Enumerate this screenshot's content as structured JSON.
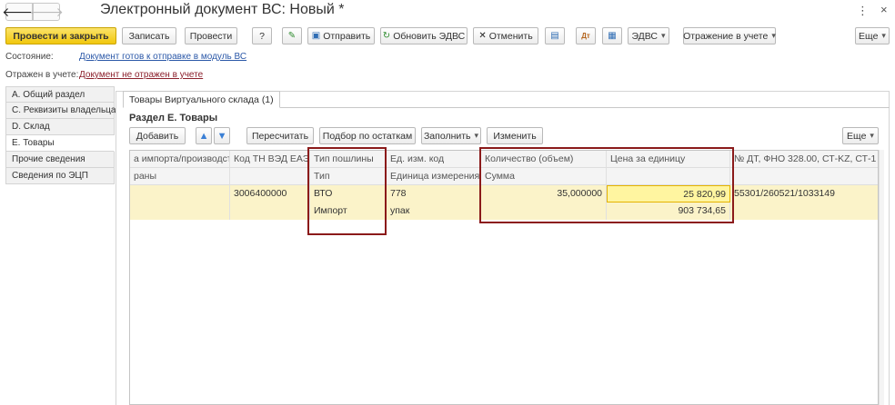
{
  "window": {
    "title": "Электронный документ ВС: Новый *",
    "back_glyph": "🡐",
    "fwd_glyph": "🡒",
    "menu_glyph": "⋮",
    "close_glyph": "×"
  },
  "toolbar": {
    "post_close": "Провести и закрыть",
    "save": "Записать",
    "post": "Провести",
    "help": "?",
    "send": "Отправить",
    "update": "Обновить ЭДВС",
    "cancel": "Отменить",
    "edvs": "ЭДВС",
    "accounting": "Отражение в учете",
    "more": "Еще"
  },
  "status": {
    "state_label": "Состояние:",
    "state_link": "Документ готов к отправке в модуль ВС",
    "accounting_label": "Отражен в учете:",
    "accounting_link": "Документ не отражен в учете"
  },
  "sidebar": {
    "items": [
      {
        "label": "A. Общий раздел"
      },
      {
        "label": "C. Реквизиты владельца"
      },
      {
        "label": "D. Склад"
      },
      {
        "label": "E. Товары"
      },
      {
        "label": "Прочие сведения"
      },
      {
        "label": "Сведения по ЭЦП"
      }
    ],
    "active_index": 3
  },
  "tab": {
    "label": "Товары Виртуального склада (1)"
  },
  "section": {
    "title": "Раздел E. Товары"
  },
  "section_toolbar": {
    "add": "Добавить",
    "recalc": "Пересчитать",
    "select_balance": "Подбор по остаткам",
    "fill": "Заполнить",
    "change": "Изменить",
    "more": "Еще"
  },
  "grid": {
    "headers_row1": [
      "а импорта/производст...",
      "Код ТН ВЭД ЕАЭС",
      "Тип пошлины",
      "Ед. изм. код",
      "Количество (объем)",
      "Цена за единицу",
      "№ ДТ, ФНО 328.00, СТ-KZ, СТ-1"
    ],
    "headers_row2": [
      "раны",
      "",
      "Тип",
      "Единица измерения",
      "Сумма",
      "",
      ""
    ],
    "rows": [
      {
        "line1": [
          "",
          "3006400000",
          "ВТО",
          "778",
          "35,000000",
          "25 820,99",
          "55301/260521/1033149"
        ],
        "line2": [
          "",
          "",
          "Импорт",
          "упак",
          "",
          "903 734,65",
          ""
        ]
      }
    ]
  },
  "colors": {
    "primary_button": "#f1c70d",
    "link": "#2b58a8",
    "highlight_border": "#8b1a1a",
    "selected_row": "#fbf3c9"
  }
}
